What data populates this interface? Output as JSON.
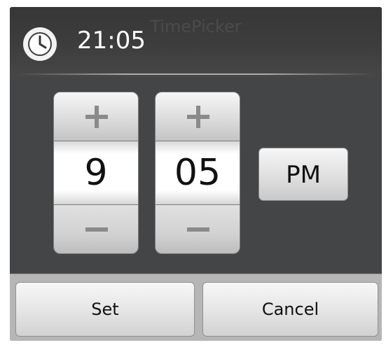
{
  "dialog": {
    "title": "21:05",
    "faded_title": "TimePicker",
    "icon": "clock-icon"
  },
  "picker": {
    "hour": {
      "value": "9",
      "increment_icon": "plus-icon",
      "decrement_icon": "minus-icon"
    },
    "minute": {
      "value": "05",
      "increment_icon": "plus-icon",
      "decrement_icon": "minus-icon"
    },
    "ampm": "PM"
  },
  "buttons": {
    "set": "Set",
    "cancel": "Cancel"
  },
  "colors": {
    "dialog_background": "#444546",
    "button_face": "#e4e4e4",
    "title_text": "#ffffff"
  }
}
